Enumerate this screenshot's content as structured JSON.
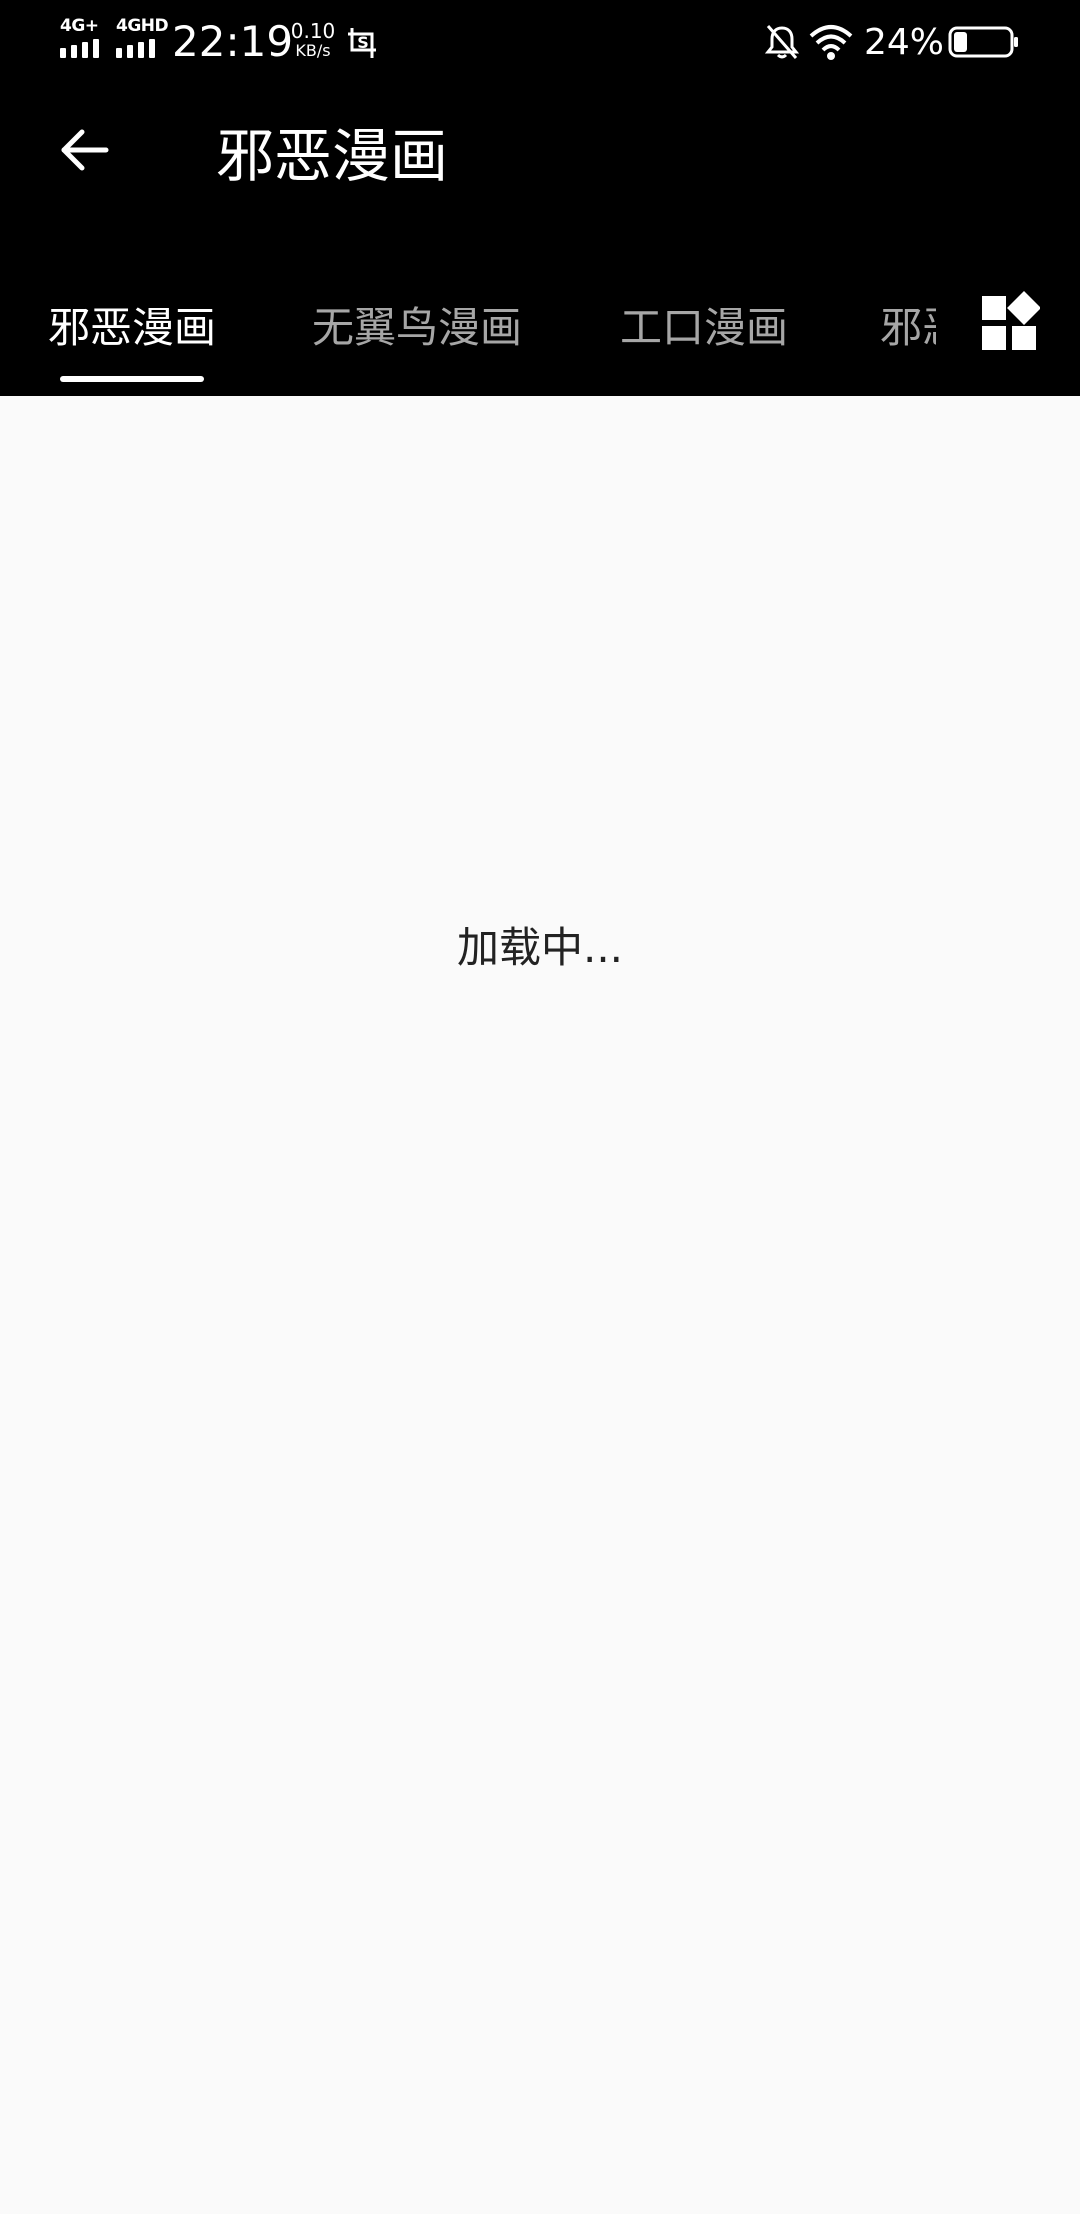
{
  "status_bar": {
    "network1": "4G+",
    "network2": "4GHD",
    "time": "22:19",
    "speed_value": "0.10",
    "speed_unit": "KB/s",
    "battery_percent": "24%",
    "battery_level": 0.24,
    "icons": [
      "signal-icon",
      "scan-icon",
      "bell-mute-icon",
      "wifi-icon",
      "battery-icon"
    ]
  },
  "toolbar": {
    "title": "邪恶漫画",
    "back_icon": "arrow-left-icon"
  },
  "tabs": {
    "items": [
      {
        "label": "邪恶漫画",
        "active": true
      },
      {
        "label": "无翼鸟漫画",
        "active": false
      },
      {
        "label": "工口漫画",
        "active": false
      },
      {
        "label": "邪恶",
        "active": false
      }
    ],
    "category_icon": "category-grid-icon"
  },
  "content": {
    "loading_text": "加载中..."
  },
  "colors": {
    "header_bg": "#000000",
    "tab_active": "#ffffff",
    "tab_inactive": "#a6a6a6",
    "content_bg": "#fafafa",
    "text": "#222222"
  }
}
